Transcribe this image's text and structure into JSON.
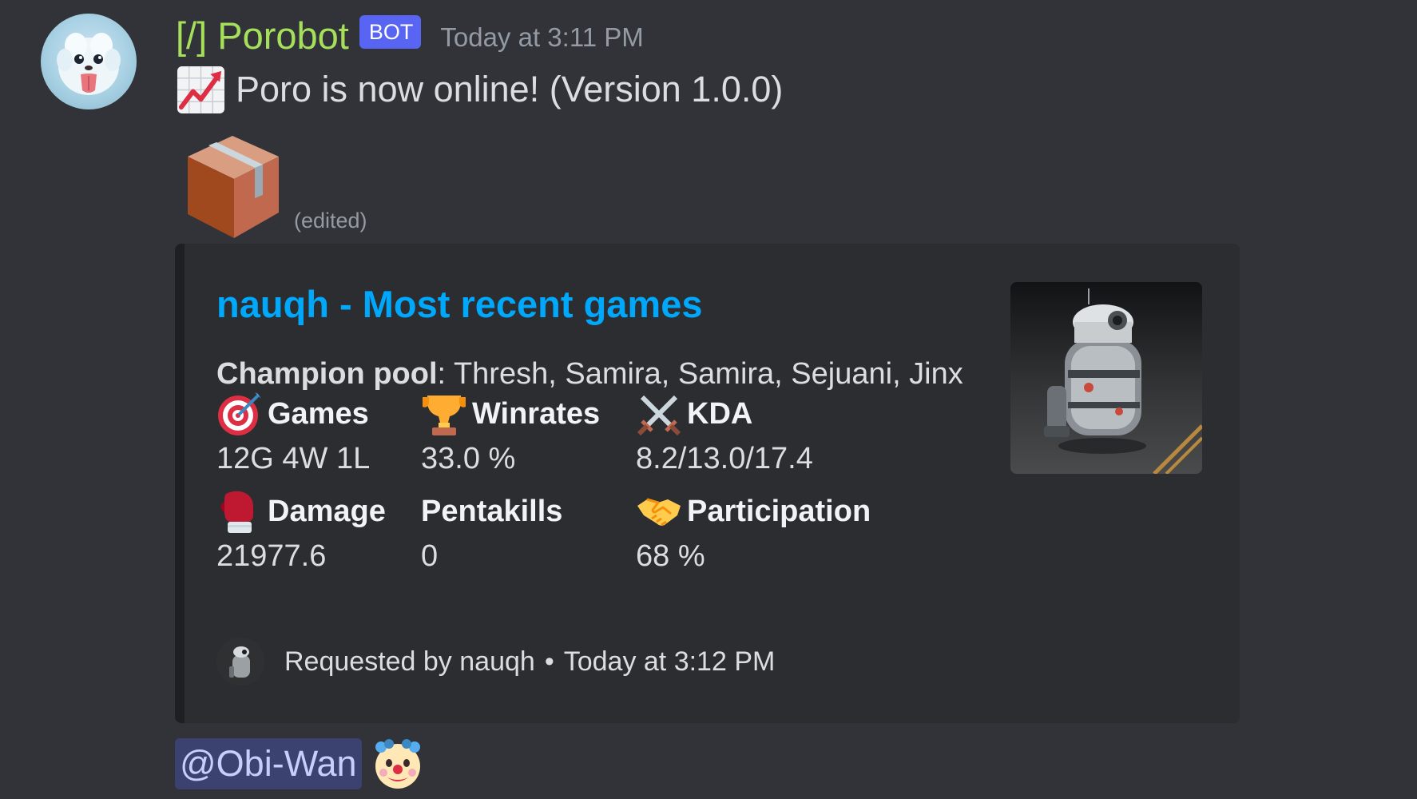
{
  "author": {
    "name": "[/] Porobot",
    "badge": "BOT",
    "timestamp": "Today at 3:11 PM",
    "avatar_icon": "poro-avatar-icon",
    "name_color": "#a6e05a"
  },
  "lines": {
    "status_emoji": "chart-increasing-icon",
    "status_text": "Poro is now online! (Version 1.0.0)",
    "package_emoji": "package-icon",
    "edited_label": "(edited)"
  },
  "embed": {
    "title": "nauqh - Most recent games",
    "title_color": "#00a8fc",
    "description_label": "Champion pool",
    "description_value": ": Thresh, Samira, Samira, Sejuani, Jinx",
    "thumbnail_icon": "robot-droid-thumbnail",
    "fields": [
      {
        "icon": "direct-hit-icon",
        "name": "Games",
        "value": "12G 4W 1L"
      },
      {
        "icon": "trophy-icon",
        "name": "Winrates",
        "value": "33.0 %"
      },
      {
        "icon": "crossed-swords-icon",
        "name": "KDA",
        "value": "8.2/13.0/17.4"
      },
      {
        "icon": "boxing-glove-icon",
        "name": "Damage",
        "value": "21977.6"
      },
      {
        "icon": "",
        "name": "Pentakills",
        "value": "0"
      },
      {
        "icon": "handshake-icon",
        "name": "Participation",
        "value": "68 %"
      }
    ],
    "footer": {
      "requested_by": "Requested by nauqh",
      "separator": "•",
      "timestamp": "Today at 3:12 PM",
      "avatar_icon": "requester-avatar-icon"
    }
  },
  "reply_line": {
    "mention": "@Obi-Wan",
    "emoji": "clown-face-icon"
  }
}
